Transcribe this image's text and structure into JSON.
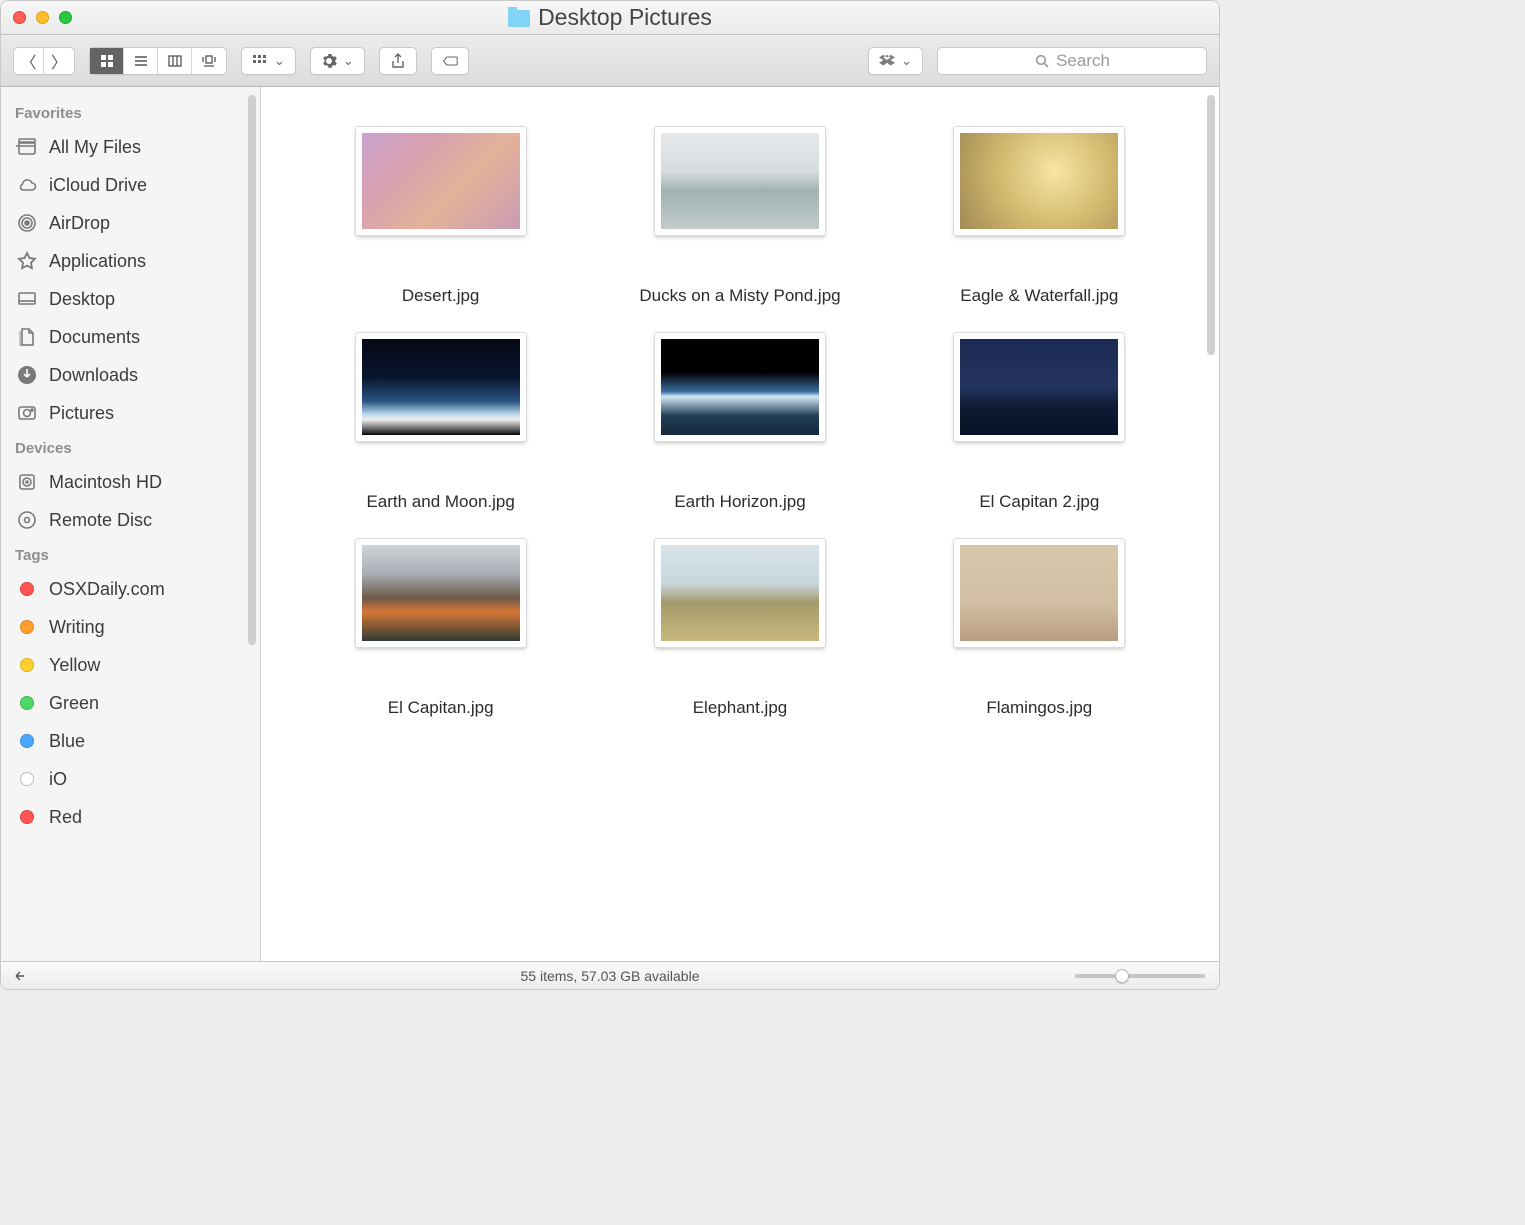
{
  "window": {
    "title": "Desktop Pictures"
  },
  "search": {
    "placeholder": "Search"
  },
  "sidebar": {
    "sections": [
      {
        "header": "Favorites",
        "items": [
          {
            "label": "All My Files",
            "icon": "all-my-files-icon"
          },
          {
            "label": "iCloud Drive",
            "icon": "icloud-icon"
          },
          {
            "label": "AirDrop",
            "icon": "airdrop-icon"
          },
          {
            "label": "Applications",
            "icon": "applications-icon"
          },
          {
            "label": "Desktop",
            "icon": "desktop-icon"
          },
          {
            "label": "Documents",
            "icon": "documents-icon"
          },
          {
            "label": "Downloads",
            "icon": "downloads-icon"
          },
          {
            "label": "Pictures",
            "icon": "pictures-icon"
          }
        ]
      },
      {
        "header": "Devices",
        "items": [
          {
            "label": "Macintosh HD",
            "icon": "hard-disk-icon"
          },
          {
            "label": "Remote Disc",
            "icon": "optical-disc-icon"
          }
        ]
      },
      {
        "header": "Tags",
        "items": [
          {
            "label": "OSXDaily.com",
            "color": "#ff5451"
          },
          {
            "label": "Writing",
            "color": "#ff9e2c"
          },
          {
            "label": "Yellow",
            "color": "#ffd02f"
          },
          {
            "label": "Green",
            "color": "#4cd964"
          },
          {
            "label": "Blue",
            "color": "#4aa7ff"
          },
          {
            "label": "iO",
            "color": "#ffffff"
          },
          {
            "label": "Red",
            "color": "#ff5451"
          }
        ]
      }
    ]
  },
  "files": [
    {
      "name": "Desert.jpg",
      "thumb": "t-desert"
    },
    {
      "name": "Ducks on a Misty Pond.jpg",
      "thumb": "t-ducks"
    },
    {
      "name": "Eagle & Waterfall.jpg",
      "thumb": "t-eagle"
    },
    {
      "name": "Earth and Moon.jpg",
      "thumb": "t-earthmoon"
    },
    {
      "name": "Earth Horizon.jpg",
      "thumb": "t-horizon"
    },
    {
      "name": "El Capitan 2.jpg",
      "thumb": "t-elcap2"
    },
    {
      "name": "El Capitan.jpg",
      "thumb": "t-elcap"
    },
    {
      "name": "Elephant.jpg",
      "thumb": "t-elephant"
    },
    {
      "name": "Flamingos.jpg",
      "thumb": "t-flamingo"
    }
  ],
  "status": {
    "text": "55 items, 57.03 GB available"
  }
}
